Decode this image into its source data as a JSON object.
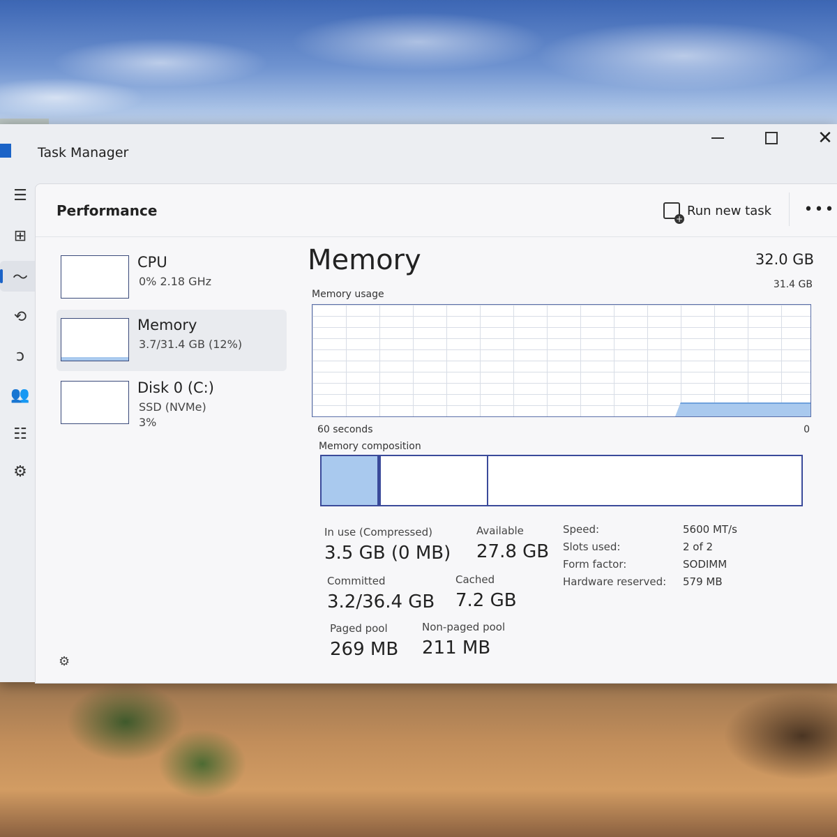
{
  "window": {
    "title": "Task Manager",
    "controls": {
      "minimize": "minimize",
      "maximize": "maximize",
      "close": "✕"
    }
  },
  "nav": {
    "items": [
      {
        "name": "hamburger-menu-icon",
        "glyph": "☰"
      },
      {
        "name": "processes-icon",
        "glyph": "⊞"
      },
      {
        "name": "performance-icon",
        "glyph": "〜",
        "active": true
      },
      {
        "name": "app-history-icon",
        "glyph": "⟲"
      },
      {
        "name": "startup-apps-icon",
        "glyph": "ↄ"
      },
      {
        "name": "users-icon",
        "glyph": "👥"
      },
      {
        "name": "details-icon",
        "glyph": "☷"
      },
      {
        "name": "services-icon",
        "glyph": "⚙"
      }
    ],
    "settings_glyph": "⚙"
  },
  "header": {
    "page_title": "Performance",
    "run_new_task": "Run new task",
    "more": "•••"
  },
  "resources": [
    {
      "name": "CPU",
      "sub": "0%  2.18 GHz",
      "sub2": ""
    },
    {
      "name": "Memory",
      "sub": "3.7/31.4 GB (12%)",
      "sub2": "",
      "selected": true
    },
    {
      "name": "Disk 0 (C:)",
      "sub": "SSD (NVMe)",
      "sub2": "3%"
    }
  ],
  "memory": {
    "title": "Memory",
    "total": "32.0 GB",
    "usage_label": "Memory usage",
    "usage_max": "31.4 GB",
    "axis_left": "60 seconds",
    "axis_right": "0",
    "composition_label": "Memory composition",
    "stats": {
      "in_use_label": "In use (Compressed)",
      "in_use_value": "3.5 GB (0 MB)",
      "available_label": "Available",
      "available_value": "27.8 GB",
      "committed_label": "Committed",
      "committed_value": "3.2/36.4 GB",
      "cached_label": "Cached",
      "cached_value": "7.2 GB",
      "paged_label": "Paged pool",
      "paged_value": "269 MB",
      "nonpaged_label": "Non-paged pool",
      "nonpaged_value": "211 MB"
    },
    "specs": [
      {
        "key": "Speed:",
        "value": "5600 MT/s"
      },
      {
        "key": "Slots used:",
        "value": "2 of 2"
      },
      {
        "key": "Form factor:",
        "value": "SODIMM"
      },
      {
        "key": "Hardware reserved:",
        "value": "579 MB"
      }
    ]
  },
  "colors": {
    "accent": "#1b63c7",
    "graph_fill": "#a9c9ee",
    "graph_border": "#3a4a9a"
  }
}
